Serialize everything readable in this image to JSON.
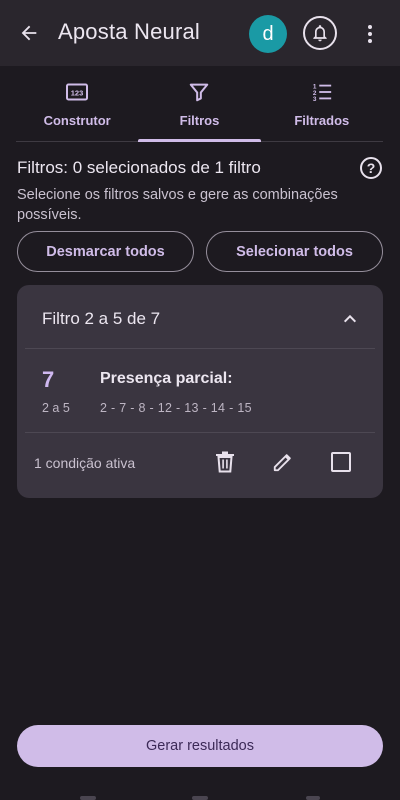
{
  "appbar": {
    "title": "Aposta Neural",
    "avatar_letter": "d",
    "avatar_color": "#1a9aa5",
    "icons": [
      "back-arrow-icon",
      "bell-icon",
      "more-vert-icon"
    ]
  },
  "tabs": [
    {
      "label": "Construtor",
      "icon": "numbers-123-icon",
      "active": false
    },
    {
      "label": "Filtros",
      "icon": "filter-icon",
      "active": true
    },
    {
      "label": "Filtrados",
      "icon": "numbered-list-icon",
      "active": false
    }
  ],
  "filters": {
    "heading": "Filtros: 0 selecionados de 1 filtro",
    "description": "Selecione os filtros salvos e gere as combinações possíveis.",
    "deselect_all_label": "Desmarcar todos",
    "select_all_label": "Selecionar todos"
  },
  "card": {
    "title": "Filtro 2 a 5 de 7",
    "number": "7",
    "range": "2 a 5",
    "condition_title": "Presença parcial:",
    "condition_values": "2 - 7 - 8 - 12 - 13 - 14 - 15",
    "active_conditions": "1 condição ativa",
    "selected": false
  },
  "generate_label": "Gerar resultados",
  "colors": {
    "background": "#1d1a20",
    "appbar": "#2a262d",
    "accent": "#d0bce8",
    "card": "#3a3540"
  }
}
